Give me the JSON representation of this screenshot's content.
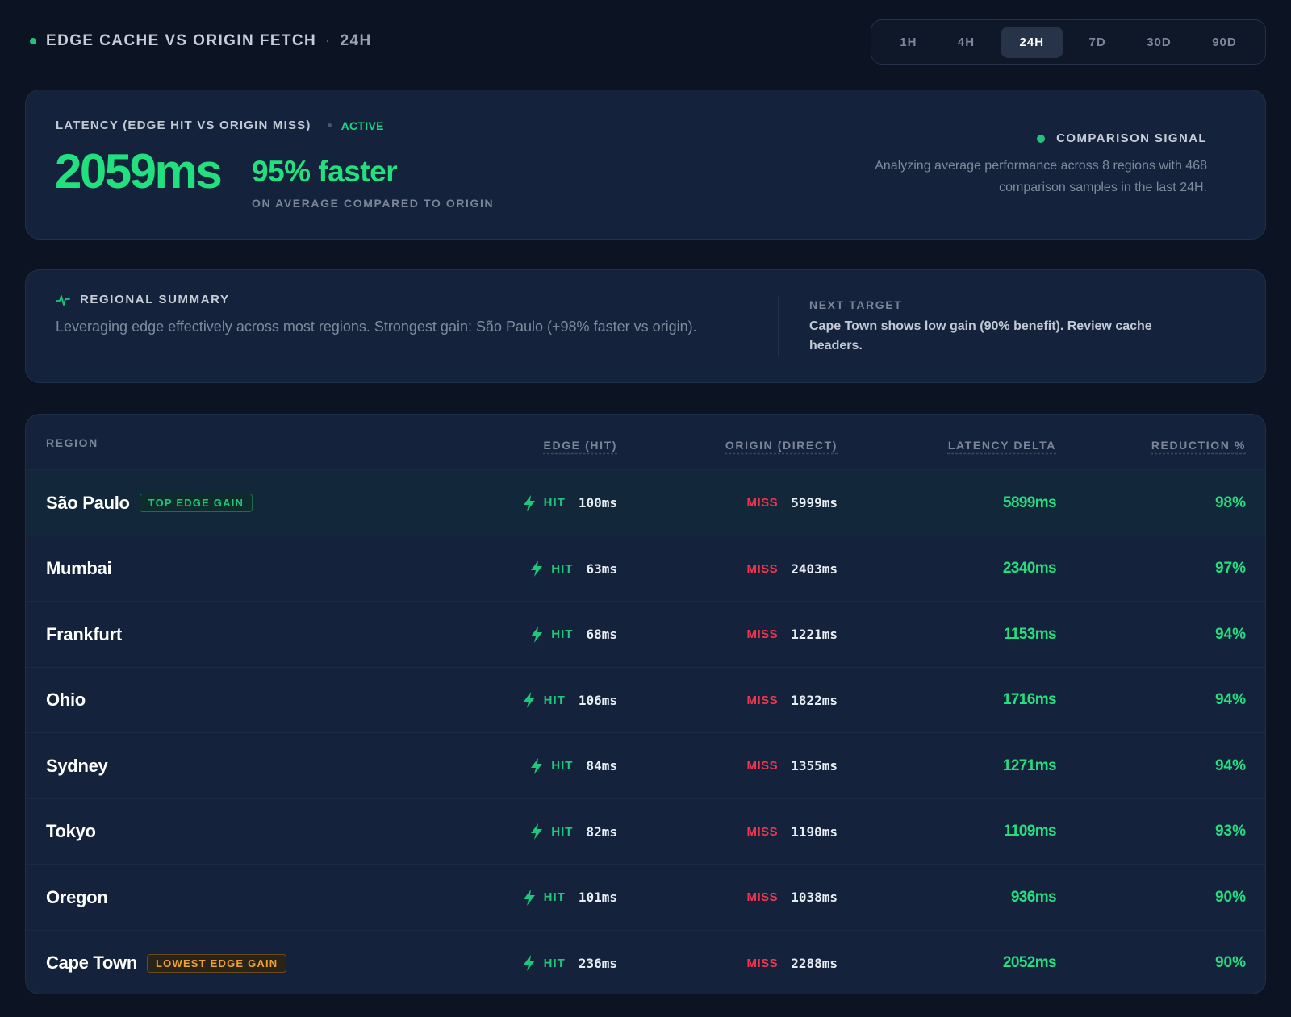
{
  "header": {
    "title": "EDGE CACHE VS ORIGIN FETCH",
    "separator": "·",
    "range": "24H"
  },
  "range_tabs": [
    {
      "label": "1H",
      "active": false
    },
    {
      "label": "4H",
      "active": false
    },
    {
      "label": "24H",
      "active": true
    },
    {
      "label": "7D",
      "active": false
    },
    {
      "label": "30D",
      "active": false
    },
    {
      "label": "90D",
      "active": false
    }
  ],
  "hero": {
    "label": "LATENCY (EDGE HIT VS ORIGIN MISS)",
    "status": "ACTIVE",
    "value": "2059ms",
    "gain": "95% faster",
    "sub": "ON AVERAGE COMPARED TO ORIGIN",
    "signal_title": "COMPARISON SIGNAL",
    "signal_text": "Analyzing average performance across 8 regions with 468 comparison samples in the last 24H."
  },
  "summary": {
    "title": "REGIONAL SUMMARY",
    "text": "Leveraging edge effectively across most regions. Strongest gain: São Paulo (+98% faster vs origin).",
    "target_label": "NEXT TARGET",
    "target_text": "Cape Town shows low gain (90% benefit). Review cache headers."
  },
  "table": {
    "columns": {
      "region": "REGION",
      "edge": "EDGE (HIT)",
      "origin": "ORIGIN (DIRECT)",
      "delta": "LATENCY DELTA",
      "reduction": "REDUCTION %"
    },
    "hit_label": "HIT",
    "miss_label": "MISS",
    "rows": [
      {
        "region": "São Paulo",
        "badge": "TOP EDGE GAIN",
        "badge_type": "best",
        "edge": "100ms",
        "origin": "5999ms",
        "delta": "5899ms",
        "reduction": "98%"
      },
      {
        "region": "Mumbai",
        "badge": "",
        "badge_type": "",
        "edge": "63ms",
        "origin": "2403ms",
        "delta": "2340ms",
        "reduction": "97%"
      },
      {
        "region": "Frankfurt",
        "badge": "",
        "badge_type": "",
        "edge": "68ms",
        "origin": "1221ms",
        "delta": "1153ms",
        "reduction": "94%"
      },
      {
        "region": "Ohio",
        "badge": "",
        "badge_type": "",
        "edge": "106ms",
        "origin": "1822ms",
        "delta": "1716ms",
        "reduction": "94%"
      },
      {
        "region": "Sydney",
        "badge": "",
        "badge_type": "",
        "edge": "84ms",
        "origin": "1355ms",
        "delta": "1271ms",
        "reduction": "94%"
      },
      {
        "region": "Tokyo",
        "badge": "",
        "badge_type": "",
        "edge": "82ms",
        "origin": "1190ms",
        "delta": "1109ms",
        "reduction": "93%"
      },
      {
        "region": "Oregon",
        "badge": "",
        "badge_type": "",
        "edge": "101ms",
        "origin": "1038ms",
        "delta": "936ms",
        "reduction": "90%"
      },
      {
        "region": "Cape Town",
        "badge": "LOWEST EDGE GAIN",
        "badge_type": "worst",
        "edge": "236ms",
        "origin": "2288ms",
        "delta": "2052ms",
        "reduction": "90%"
      }
    ]
  },
  "colors": {
    "background": "#0c1322",
    "card": "#14233b",
    "accent_green": "#23e07f",
    "miss_red": "#f0364f",
    "badge_orange": "#f0a02c"
  },
  "icons": {
    "status_dot": "live-dot-icon",
    "summary": "pulse-icon",
    "edge_hit": "bolt-icon"
  }
}
